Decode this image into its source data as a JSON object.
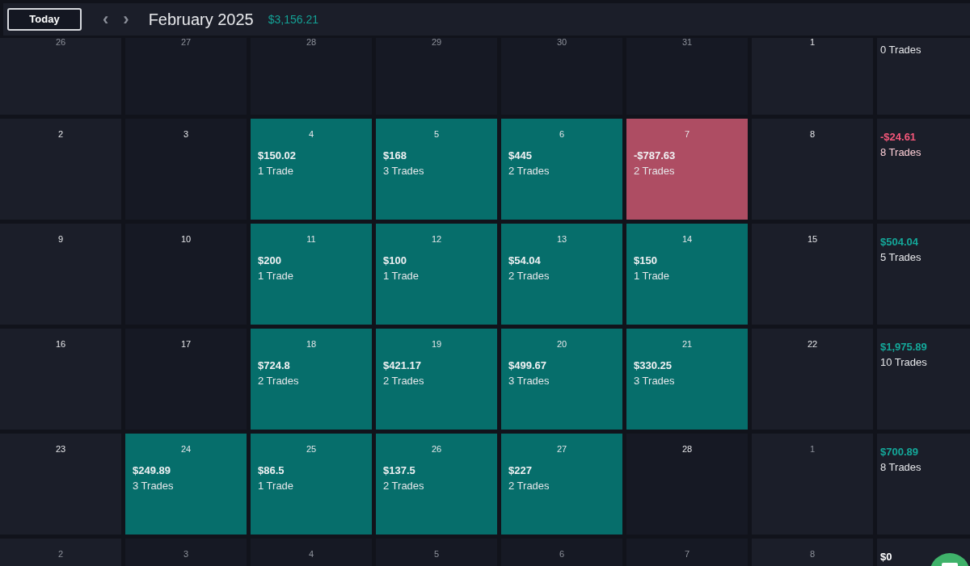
{
  "header": {
    "today_button": "Today",
    "prev_label": "‹",
    "next_label": "›",
    "title": "February 2025",
    "total": "$3,156.21"
  },
  "weeks": [
    {
      "days": [
        {
          "date": "26",
          "outside": true,
          "kind": "none"
        },
        {
          "date": "27",
          "outside": true,
          "kind": "none"
        },
        {
          "date": "28",
          "outside": true,
          "kind": "none"
        },
        {
          "date": "29",
          "outside": true,
          "kind": "none"
        },
        {
          "date": "30",
          "outside": true,
          "kind": "none"
        },
        {
          "date": "31",
          "outside": true,
          "kind": "none"
        },
        {
          "date": "1",
          "outside": false,
          "kind": "none"
        }
      ],
      "summary": {
        "kind": "neutral",
        "trades": "0 Trades"
      }
    },
    {
      "days": [
        {
          "date": "2",
          "outside": false,
          "kind": "none"
        },
        {
          "date": "3",
          "outside": false,
          "kind": "none"
        },
        {
          "date": "4",
          "outside": false,
          "kind": "win",
          "pnl": "$150.02",
          "trades": "1 Trade"
        },
        {
          "date": "5",
          "outside": false,
          "kind": "win",
          "pnl": "$168",
          "trades": "3 Trades"
        },
        {
          "date": "6",
          "outside": false,
          "kind": "win",
          "pnl": "$445",
          "trades": "2 Trades"
        },
        {
          "date": "7",
          "outside": false,
          "kind": "loss",
          "pnl": "-$787.63",
          "trades": "2 Trades"
        },
        {
          "date": "8",
          "outside": false,
          "kind": "none"
        }
      ],
      "summary": {
        "kind": "negative",
        "pnl": "-$24.61",
        "trades": "8 Trades"
      }
    },
    {
      "days": [
        {
          "date": "9",
          "outside": false,
          "kind": "none"
        },
        {
          "date": "10",
          "outside": false,
          "kind": "none"
        },
        {
          "date": "11",
          "outside": false,
          "kind": "win",
          "pnl": "$200",
          "trades": "1 Trade"
        },
        {
          "date": "12",
          "outside": false,
          "kind": "win",
          "pnl": "$100",
          "trades": "1 Trade"
        },
        {
          "date": "13",
          "outside": false,
          "kind": "win",
          "pnl": "$54.04",
          "trades": "2 Trades"
        },
        {
          "date": "14",
          "outside": false,
          "kind": "win",
          "pnl": "$150",
          "trades": "1 Trade"
        },
        {
          "date": "15",
          "outside": false,
          "kind": "none"
        }
      ],
      "summary": {
        "kind": "positive",
        "pnl": "$504.04",
        "trades": "5 Trades"
      }
    },
    {
      "days": [
        {
          "date": "16",
          "outside": false,
          "kind": "none"
        },
        {
          "date": "17",
          "outside": false,
          "kind": "none"
        },
        {
          "date": "18",
          "outside": false,
          "kind": "win",
          "pnl": "$724.8",
          "trades": "2 Trades"
        },
        {
          "date": "19",
          "outside": false,
          "kind": "win",
          "pnl": "$421.17",
          "trades": "2 Trades"
        },
        {
          "date": "20",
          "outside": false,
          "kind": "win",
          "pnl": "$499.67",
          "trades": "3 Trades"
        },
        {
          "date": "21",
          "outside": false,
          "kind": "win",
          "pnl": "$330.25",
          "trades": "3 Trades"
        },
        {
          "date": "22",
          "outside": false,
          "kind": "none"
        }
      ],
      "summary": {
        "kind": "positive",
        "pnl": "$1,975.89",
        "trades": "10 Trades"
      }
    },
    {
      "days": [
        {
          "date": "23",
          "outside": false,
          "kind": "none"
        },
        {
          "date": "24",
          "outside": false,
          "kind": "win",
          "pnl": "$249.89",
          "trades": "3 Trades"
        },
        {
          "date": "25",
          "outside": false,
          "kind": "win",
          "pnl": "$86.5",
          "trades": "1 Trade"
        },
        {
          "date": "26",
          "outside": false,
          "kind": "win",
          "pnl": "$137.5",
          "trades": "2 Trades"
        },
        {
          "date": "27",
          "outside": false,
          "kind": "win",
          "pnl": "$227",
          "trades": "2 Trades"
        },
        {
          "date": "28",
          "outside": false,
          "kind": "none"
        },
        {
          "date": "1",
          "outside": true,
          "kind": "none"
        }
      ],
      "summary": {
        "kind": "positive",
        "pnl": "$700.89",
        "trades": "8 Trades"
      }
    },
    {
      "days": [
        {
          "date": "2",
          "outside": true,
          "kind": "none"
        },
        {
          "date": "3",
          "outside": true,
          "kind": "none"
        },
        {
          "date": "4",
          "outside": true,
          "kind": "none"
        },
        {
          "date": "5",
          "outside": true,
          "kind": "none"
        },
        {
          "date": "6",
          "outside": true,
          "kind": "none"
        },
        {
          "date": "7",
          "outside": true,
          "kind": "none"
        },
        {
          "date": "8",
          "outside": true,
          "kind": "none"
        }
      ],
      "summary": {
        "kind": "neutral",
        "pnl": "$0"
      }
    }
  ]
}
